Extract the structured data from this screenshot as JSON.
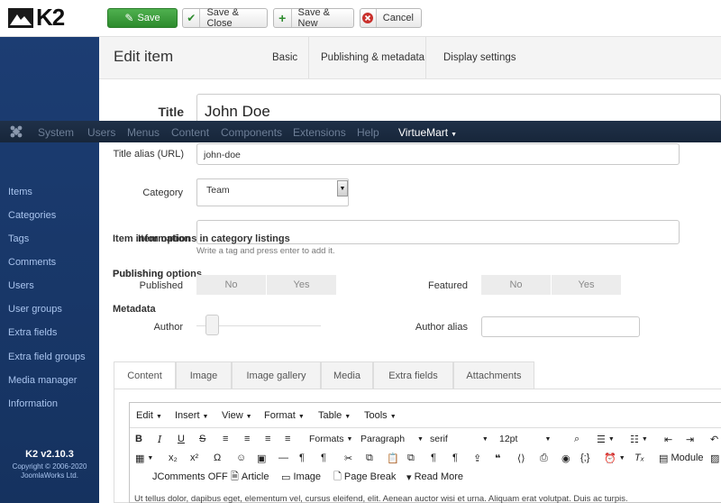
{
  "brand": {
    "logo_text": "K2"
  },
  "toolbar": {
    "save_label": "Save",
    "save_close_label": "Save & Close",
    "save_new_label": "Save & New",
    "cancel_label": "Cancel"
  },
  "sidebar": {
    "items": [
      {
        "label": "Items"
      },
      {
        "label": "Categories"
      },
      {
        "label": "Tags"
      },
      {
        "label": "Comments"
      },
      {
        "label": "Users"
      },
      {
        "label": "User groups"
      },
      {
        "label": "Extra fields"
      },
      {
        "label": "Extra field groups"
      },
      {
        "label": "Media manager"
      },
      {
        "label": "Information"
      }
    ],
    "version": "K2 v2.10.3",
    "copyright_line1": "Copyright © 2006-2020",
    "copyright_line2": "JoomlaWorks Ltd."
  },
  "header": {
    "title": "Edit item",
    "tabs": [
      {
        "label": "Basic"
      },
      {
        "label": "Publishing & metadata"
      },
      {
        "label": "Display settings"
      }
    ]
  },
  "joomla_menu": {
    "items": [
      "System",
      "Users",
      "Menus",
      "Content",
      "Components",
      "Extensions",
      "Help"
    ],
    "virtuemart": "VirtueMart"
  },
  "form": {
    "title_label": "Title",
    "title_value": "John Doe",
    "alias_label": "Title alias (URL)",
    "alias_value": "john-doe",
    "category_label": "Category",
    "category_value": "Team",
    "tags_help": "Write a tag and press enter to add it.",
    "overlap_1a": "Item information",
    "overlap_1b": "Item options in category listings",
    "overlap_2a": "Publishing options",
    "overlap_2b": "Publishing",
    "metadata_heading": "Metadata",
    "published_label": "Published",
    "published_no": "No",
    "published_yes": "Yes",
    "featured_label": "Featured",
    "featured_no": "No",
    "featured_yes": "Yes",
    "author_label": "Author",
    "author_alias_label": "Author alias"
  },
  "content_tabs": [
    "Content",
    "Image",
    "Image gallery",
    "Media",
    "Extra fields",
    "Attachments"
  ],
  "editor": {
    "menu": [
      "Edit",
      "Insert",
      "View",
      "Format",
      "Table",
      "Tools"
    ],
    "formats": "Formats",
    "paragraph": "Paragraph",
    "font": "serif",
    "size": "12pt",
    "module": "Module",
    "jcomments": "JComments OFF",
    "article": "Article",
    "image": "Image",
    "page_break": "Page Break",
    "read_more": "Read More",
    "body_text": "Ut tellus dolor, dapibus eget, elementum vel, cursus eleifend, elit. Aenean auctor wisi et urna. Aliquam erat volutpat. Duis ac turpis."
  }
}
